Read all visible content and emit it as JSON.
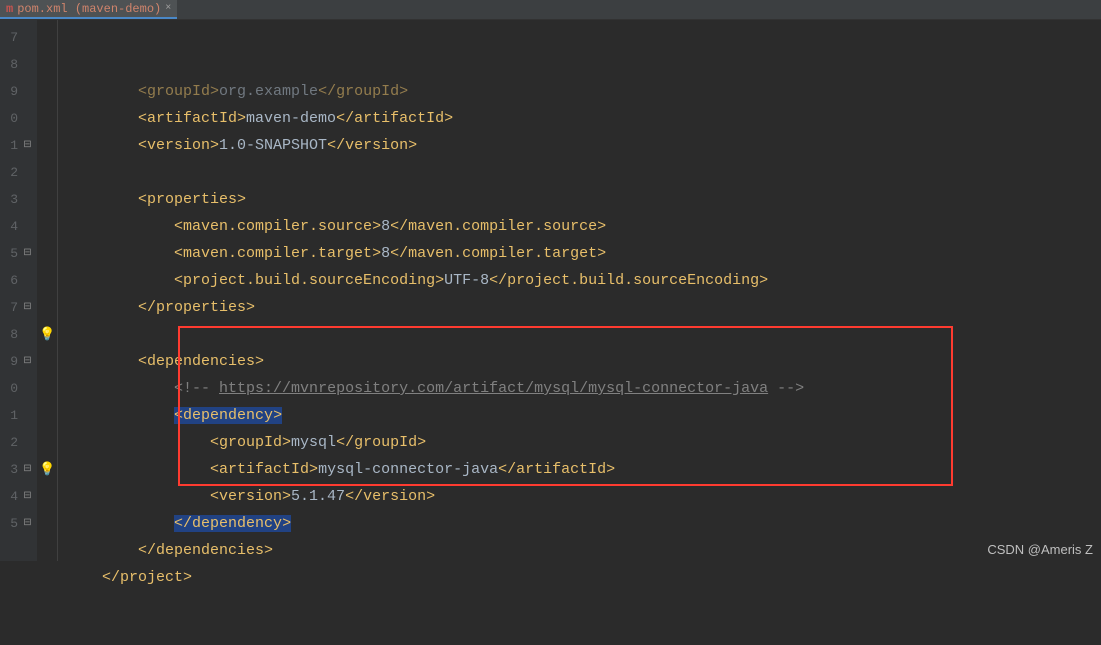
{
  "tab": {
    "icon": "m",
    "label": "pom.xml (maven-demo)",
    "close": "×"
  },
  "gutter": {
    "line_numbers": [
      "7",
      "8",
      "9",
      "0",
      "1",
      "2",
      "3",
      "4",
      "5",
      "6",
      "7",
      "8",
      "9",
      "0",
      "1",
      "2",
      "3",
      "4",
      "5"
    ]
  },
  "code": {
    "lines": [
      {
        "indent": "        ",
        "parts": [
          {
            "t": "<groupId>",
            "c": "tag"
          },
          {
            "t": "org.example",
            "c": "txt"
          },
          {
            "t": "</groupId>",
            "c": "tag"
          }
        ],
        "dim": true
      },
      {
        "indent": "        ",
        "parts": [
          {
            "t": "<artifactId>",
            "c": "tag"
          },
          {
            "t": "maven-demo",
            "c": "txt"
          },
          {
            "t": "</artifactId>",
            "c": "tag"
          }
        ]
      },
      {
        "indent": "        ",
        "parts": [
          {
            "t": "<version>",
            "c": "tag"
          },
          {
            "t": "1.0-SNAPSHOT",
            "c": "txt"
          },
          {
            "t": "</version>",
            "c": "tag"
          }
        ]
      },
      {
        "indent": "",
        "parts": []
      },
      {
        "indent": "        ",
        "parts": [
          {
            "t": "<properties>",
            "c": "tag"
          }
        ]
      },
      {
        "indent": "            ",
        "parts": [
          {
            "t": "<maven.compiler.source>",
            "c": "tag"
          },
          {
            "t": "8",
            "c": "txt"
          },
          {
            "t": "</maven.compiler.source>",
            "c": "tag"
          }
        ]
      },
      {
        "indent": "            ",
        "parts": [
          {
            "t": "<maven.compiler.target>",
            "c": "tag"
          },
          {
            "t": "8",
            "c": "txt"
          },
          {
            "t": "</maven.compiler.target>",
            "c": "tag"
          }
        ]
      },
      {
        "indent": "            ",
        "parts": [
          {
            "t": "<project.build.sourceEncoding>",
            "c": "tag"
          },
          {
            "t": "UTF-8",
            "c": "txt"
          },
          {
            "t": "</project.build.sourceEncoding>",
            "c": "tag"
          }
        ]
      },
      {
        "indent": "        ",
        "parts": [
          {
            "t": "</properties>",
            "c": "tag"
          }
        ]
      },
      {
        "indent": "",
        "parts": []
      },
      {
        "indent": "        ",
        "parts": [
          {
            "t": "<dependencies>",
            "c": "tag"
          }
        ]
      },
      {
        "indent": "            ",
        "parts": [
          {
            "t": "<!-- ",
            "c": "comment"
          },
          {
            "t": "https://mvnrepository.com/artifact/mysql/mysql-connector-java",
            "c": "link"
          },
          {
            "t": " -->",
            "c": "comment"
          }
        ]
      },
      {
        "indent": "            ",
        "parts": [
          {
            "t": "<",
            "c": "tag hl"
          },
          {
            "t": "dependency",
            "c": "tag hl"
          },
          {
            "t": ">",
            "c": "tag hl"
          }
        ]
      },
      {
        "indent": "                ",
        "parts": [
          {
            "t": "<groupId>",
            "c": "tag"
          },
          {
            "t": "mysql",
            "c": "txt"
          },
          {
            "t": "</groupId>",
            "c": "tag"
          }
        ]
      },
      {
        "indent": "                ",
        "parts": [
          {
            "t": "<artifactId>",
            "c": "tag"
          },
          {
            "t": "mysql-connector-java",
            "c": "txt"
          },
          {
            "t": "</artifactId>",
            "c": "tag"
          }
        ]
      },
      {
        "indent": "                ",
        "parts": [
          {
            "t": "<version>",
            "c": "tag"
          },
          {
            "t": "5.1.47",
            "c": "txt"
          },
          {
            "t": "</version>",
            "c": "tag"
          }
        ]
      },
      {
        "indent": "            ",
        "parts": [
          {
            "t": "</dependency",
            "c": "tag hl"
          },
          {
            "t": ">",
            "c": "tag hl"
          }
        ]
      },
      {
        "indent": "        ",
        "parts": [
          {
            "t": "</dependencies>",
            "c": "tag"
          }
        ]
      },
      {
        "indent": "    ",
        "parts": [
          {
            "t": "</project>",
            "c": "tag"
          }
        ]
      }
    ]
  },
  "fold_markers": {
    "4": "⊟",
    "8": "⊟",
    "10": "⊟",
    "12": "⊟",
    "16": "⊟",
    "17": "⊟",
    "18": "⊟"
  },
  "indent_markers": {
    "11": "bulb",
    "16": "bulb"
  },
  "watermark": "CSDN @Ameris Z"
}
